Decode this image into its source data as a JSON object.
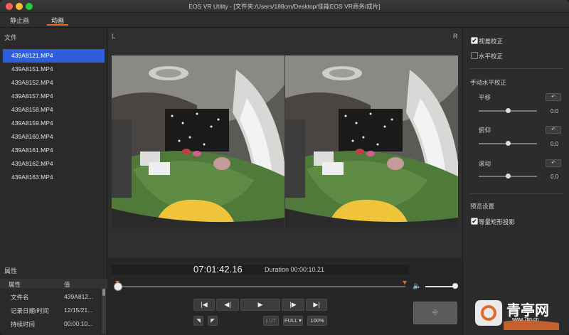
{
  "window": {
    "title": "EOS VR Utility - [文件夹:/Users/188cm/Desktop/佳能EOS VR商务/成片]"
  },
  "tabs": [
    {
      "label": "静止画"
    },
    {
      "label": "动画"
    }
  ],
  "files": {
    "header": "文件",
    "items": [
      "439A8121.MP4",
      "439A8151.MP4",
      "439A8152.MP4",
      "439A8157.MP4",
      "439A8158.MP4",
      "439A8159.MP4",
      "439A8160.MP4",
      "439A8161.MP4",
      "439A8162.MP4",
      "439A8163.MP4"
    ],
    "selected_index": 0
  },
  "properties": {
    "header": "属性",
    "col_name": "属性",
    "col_value": "值",
    "rows": [
      {
        "name": "文件名",
        "value": "439A812..."
      },
      {
        "name": "记录日期/时间",
        "value": "12/15/21..."
      },
      {
        "name": "持续时间",
        "value": "00:00:10..."
      }
    ]
  },
  "preview": {
    "left_label": "L",
    "right_label": "R"
  },
  "playback": {
    "timecode": "07:01:42.16",
    "duration": "Duration 00:00:10.21",
    "position": 0.0,
    "volume": 1.0,
    "buttons": {
      "first": "|◀",
      "prev_frame": "◀|",
      "play": "▶",
      "next_frame": "|▶",
      "last": "▶|",
      "mark_in": "◥",
      "mark_out": "◤",
      "lut": "LUT",
      "full": "FULL ▾",
      "zoom": "100%"
    }
  },
  "right_panel": {
    "parallax": {
      "label": "视差校正",
      "checked": true
    },
    "horizon": {
      "label": "水平校正",
      "checked": false
    },
    "manual_header": "手动水平校正",
    "sliders": [
      {
        "label": "平移",
        "value": "0.0"
      },
      {
        "label": "俯仰",
        "value": "0.0"
      },
      {
        "label": "滚动",
        "value": "0.0"
      }
    ],
    "preview_header": "预览设置",
    "equirect": {
      "label": "等量矩形投影",
      "checked": true
    }
  },
  "watermark": {
    "name": "青亭网",
    "url": "www.7tin.cn"
  },
  "colors": {
    "accent": "#e06a2c",
    "selection": "#2f5fd8"
  }
}
